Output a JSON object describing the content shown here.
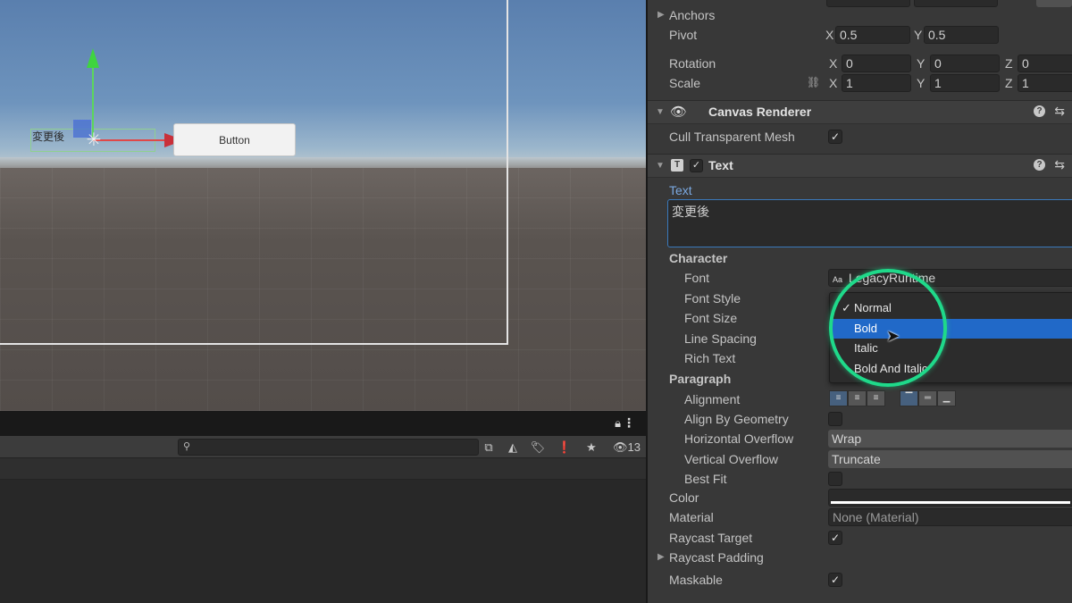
{
  "scene": {
    "text_label": "変更後",
    "button_label": "Button"
  },
  "project": {
    "search_placeholder": "",
    "hidden_count": "13"
  },
  "inspector": {
    "transform": {
      "anchors_label": "Anchors",
      "pivot": {
        "label": "Pivot",
        "x": "0.5",
        "y": "0.5"
      },
      "rotation": {
        "label": "Rotation",
        "x": "0",
        "y": "0",
        "z": "0"
      },
      "scale": {
        "label": "Scale",
        "x": "1",
        "y": "1",
        "z": "1"
      },
      "axis_x": "X",
      "axis_y": "Y",
      "axis_z": "Z"
    },
    "canvas_renderer": {
      "title": "Canvas Renderer",
      "cull_label": "Cull Transparent Mesh",
      "cull_checked": true
    },
    "text_component": {
      "title": "Text",
      "text_label": "Text",
      "text_value": "変更後",
      "character_label": "Character",
      "font_label": "Font",
      "font_value": "LegacyRuntime",
      "font_prefix": "Aa",
      "font_style_label": "Font Style",
      "font_size_label": "Font Size",
      "line_spacing_label": "Line Spacing",
      "rich_text_label": "Rich Text",
      "paragraph_label": "Paragraph",
      "alignment_label": "Alignment",
      "align_by_geometry_label": "Align By Geometry",
      "horizontal_overflow_label": "Horizontal Overflow",
      "horizontal_overflow_value": "Wrap",
      "vertical_overflow_label": "Vertical Overflow",
      "vertical_overflow_value": "Truncate",
      "best_fit_label": "Best Fit",
      "color_label": "Color",
      "color_value": "#ffffff",
      "material_label": "Material",
      "material_value": "None (Material)",
      "raycast_target_label": "Raycast Target",
      "raycast_padding_label": "Raycast Padding",
      "maskable_label": "Maskable"
    }
  },
  "font_style_menu": {
    "items": [
      "Normal",
      "Bold",
      "Italic",
      "Bold And Italic"
    ],
    "checked": "Normal",
    "hovered": "Bold",
    "check_glyph": "✓"
  },
  "colors": {
    "accent_blue": "#2169c8",
    "highlight_ring": "#1fd98a",
    "text_area_border": "#3a79bb"
  }
}
